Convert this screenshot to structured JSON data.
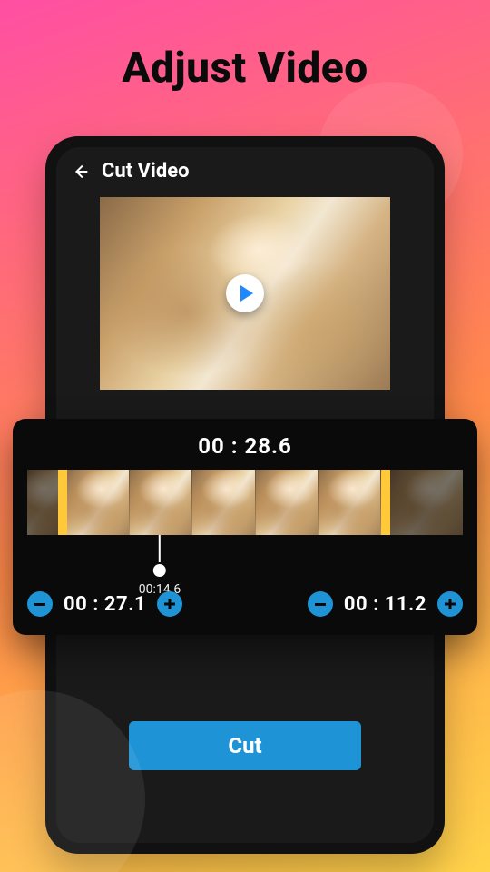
{
  "promo": {
    "title": "Adjust Video"
  },
  "app_bar": {
    "title": "Cut Video"
  },
  "cut": {
    "total_time": "00 : 28.6",
    "playhead_time": "00:14.6",
    "start_time": "00 : 27.1",
    "end_time": "00 : 11.2"
  },
  "buttons": {
    "cut": "Cut"
  },
  "colors": {
    "accent": "#1e93d6",
    "handle": "#ffc93a"
  }
}
